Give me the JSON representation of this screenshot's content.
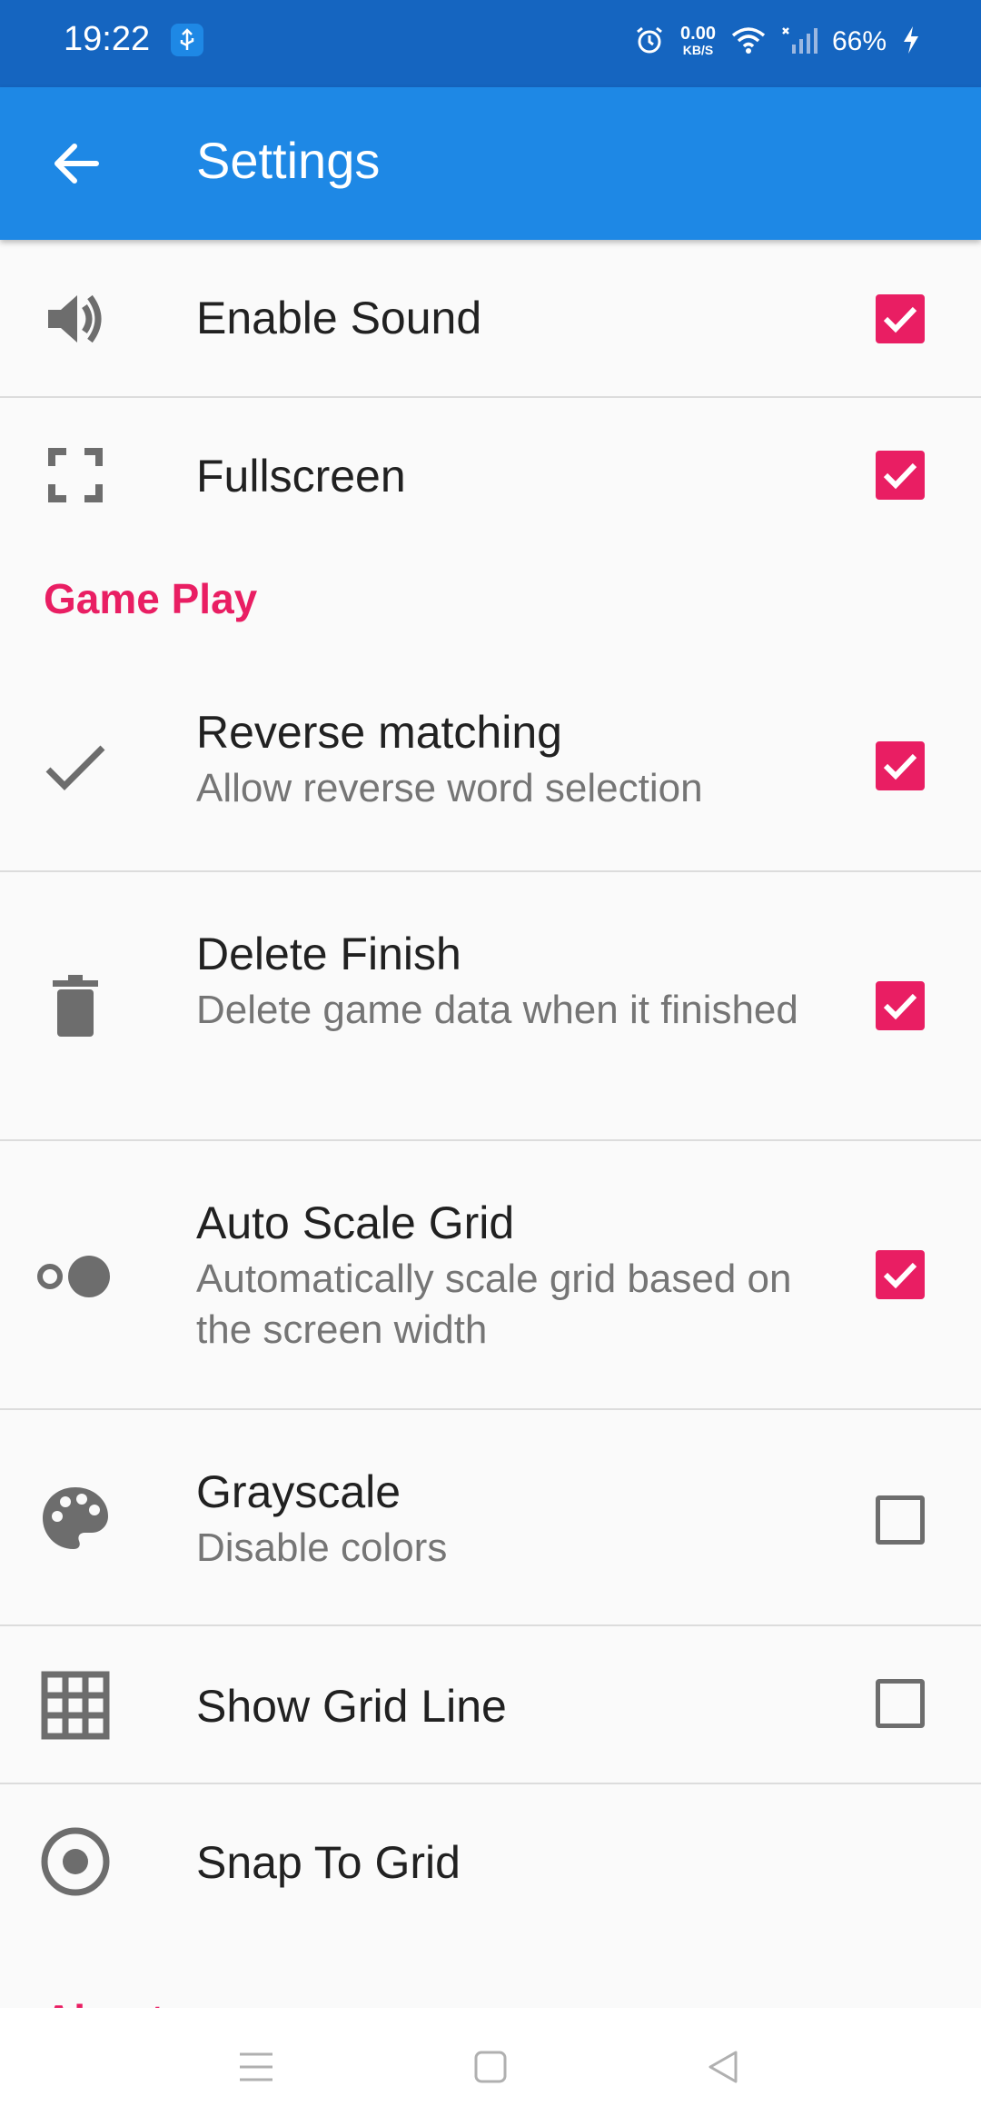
{
  "status_bar": {
    "time": "19:22",
    "net_speed_value": "0.00",
    "net_speed_unit": "KB/S",
    "battery": "66%"
  },
  "app_bar": {
    "title": "Settings"
  },
  "settings": {
    "enable_sound": {
      "title": "Enable Sound",
      "checked": true
    },
    "fullscreen": {
      "title": "Fullscreen",
      "checked": true
    },
    "game_play_header": "Game Play",
    "reverse_matching": {
      "title": "Reverse matching",
      "summary": "Allow reverse word selection",
      "checked": true
    },
    "delete_finish": {
      "title": "Delete Finish",
      "summary": "Delete game data when it finished",
      "checked": true
    },
    "auto_scale_grid": {
      "title": "Auto Scale Grid",
      "summary": "Automatically scale grid based on the screen width",
      "checked": true
    },
    "grayscale": {
      "title": "Grayscale",
      "summary": "Disable colors",
      "checked": false
    },
    "show_grid_line": {
      "title": "Show Grid Line",
      "checked": false
    },
    "snap_to_grid": {
      "title": "Snap To Grid"
    },
    "about_header": "About"
  },
  "colors": {
    "status_bar": "#1565c0",
    "app_bar": "#1e88e5",
    "accent": "#e91e63",
    "background": "#fafafa"
  },
  "icons": {
    "back": "arrow-left-icon",
    "sound": "volume-icon",
    "fullscreen": "fullscreen-icon",
    "reverse": "check-icon",
    "delete": "trash-icon",
    "autoscale": "dots-scale-icon",
    "grayscale": "palette-icon",
    "gridline": "grid-icon",
    "snap": "radio-target-icon"
  }
}
